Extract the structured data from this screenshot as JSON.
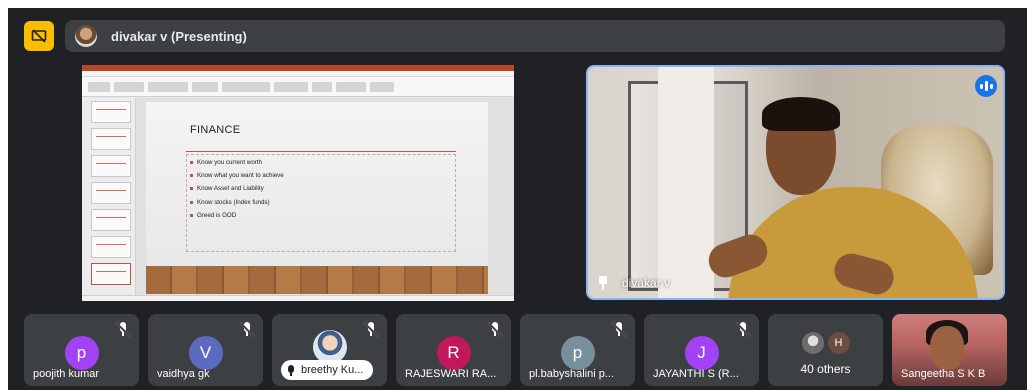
{
  "top_bar": {
    "presenter_label": "divakar v (Presenting)"
  },
  "slide": {
    "title": "FINANCE",
    "bullets": [
      "Know you current worth",
      "Know what you want to achieve",
      "Know Asset and Liability",
      "Know stocks (Index funds)",
      "Greed is GOD"
    ]
  },
  "speaker": {
    "name": "divakar v"
  },
  "participants": [
    {
      "initial": "p",
      "name": "poojith kumar",
      "color": "#a142f4"
    },
    {
      "initial": "V",
      "name": "vaidhya gk",
      "color": "#5c6bc0"
    },
    {
      "initial": "",
      "name": "breethy Ku...",
      "color": ""
    },
    {
      "initial": "R",
      "name": "RAJESWARI RA...",
      "color": "#c2185b"
    },
    {
      "initial": "p",
      "name": "pl.babyshalini p...",
      "color": "#78909c"
    },
    {
      "initial": "J",
      "name": "JAYANTHI S (R...",
      "color": "#a142f4"
    }
  ],
  "others": {
    "avatar_initial": "H",
    "label": "40 others"
  },
  "last_tile": {
    "name": "Sangeetha S K B"
  },
  "colors": {
    "accent": "#8ab4f8",
    "tile_bg": "#3c4043",
    "stage_bg": "#202124",
    "badge": "#fbbc04"
  }
}
